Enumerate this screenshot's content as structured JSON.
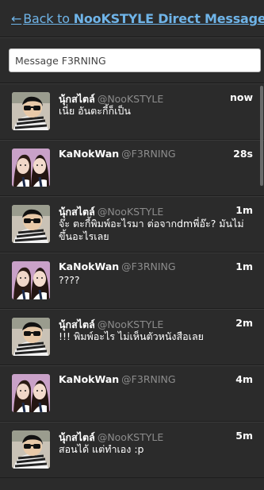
{
  "header": {
    "back_arrow": "←",
    "back_prefix": "Back to ",
    "back_handle": "NooKSTYLE Direct Messages"
  },
  "compose": {
    "value": "Message F3RNING"
  },
  "messages": [
    {
      "sender": "นุ้กสไตล์",
      "handle": "@NooKSTYLE",
      "time": "now",
      "text": "เนี่ย อันตะกี้ก็เป็น",
      "avatar": "nook"
    },
    {
      "sender": "KaNokWan",
      "handle": "@F3RNING",
      "time": "28s",
      "text": "",
      "avatar": "kanok"
    },
    {
      "sender": "นุ้กสไตล์",
      "handle": "@NooKSTYLE",
      "time": "1m",
      "text": "จ๊ะ ตะกี้พิมพ์อะไรมา ต่อจากdmพี่อ๊ะ? มันไม่ขึ้นอะไรเลย",
      "avatar": "nook"
    },
    {
      "sender": "KaNokWan",
      "handle": "@F3RNING",
      "time": "1m",
      "text": "????",
      "avatar": "kanok"
    },
    {
      "sender": "นุ้กสไตล์",
      "handle": "@NooKSTYLE",
      "time": "2m",
      "text": "!!! พิมพ์อะไร ไม่เห็นตัวหนังสือเลย",
      "avatar": "nook"
    },
    {
      "sender": "KaNokWan",
      "handle": "@F3RNING",
      "time": "4m",
      "text": "",
      "avatar": "kanok"
    },
    {
      "sender": "นุ้กสไตล์",
      "handle": "@NooKSTYLE",
      "time": "5m",
      "text": "สอนได้ แต่ทำเอง :p",
      "avatar": "nook"
    }
  ]
}
